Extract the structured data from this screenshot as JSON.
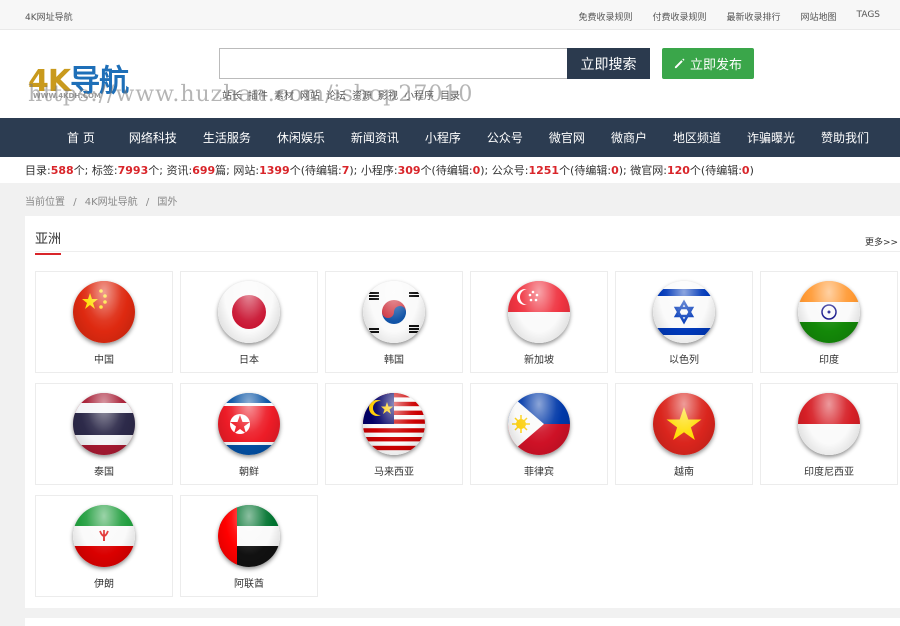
{
  "topbar": {
    "site_name": "4K网址导航",
    "links": [
      "免费收录规则",
      "付费收录规则",
      "最新收录排行",
      "网站地图",
      "TAGS"
    ]
  },
  "header": {
    "logo_text_k": "4K",
    "logo_text": "导航",
    "logo_sub": "WWW.4KDH.COM",
    "search_placeholder": "",
    "search_button": "立即搜索",
    "publish_button": "立即发布",
    "hotwords": [
      "站长",
      "插件",
      "素材",
      "网站",
      "论坛",
      "资源",
      "影视",
      "小程序",
      "目录"
    ],
    "watermark": "https://www.huzhan.com/ishop27010"
  },
  "nav": [
    "首 页",
    "网络科技",
    "生活服务",
    "休闲娱乐",
    "新闻资讯",
    "小程序",
    "公众号",
    "微官网",
    "微商户",
    "地区频道",
    "诈骗曝光",
    "赞助我们"
  ],
  "stats": {
    "dir_label": "目录:",
    "dir_count": "588",
    "dir_unit": "个;",
    "tag_label": "标签:",
    "tag_count": "7993",
    "tag_unit": "个;",
    "news_label": "资讯:",
    "news_count": "699",
    "news_unit": "篇;",
    "site_label": "网站:",
    "site_count": "1399",
    "site_pending_pre": "个(待编辑:",
    "site_pending": "7",
    "site_pending_post": ");",
    "mini_label": "小程序:",
    "mini_count": "309",
    "mini_pending_pre": "个(待编辑:",
    "mini_pending": "0",
    "mini_pending_post": ");",
    "mp_label": "公众号:",
    "mp_count": "1251",
    "mp_pending_pre": "个(待编辑:",
    "mp_pending": "0",
    "mp_pending_post": ");",
    "wg_label": "微官网:",
    "wg_count": "120",
    "wg_pending_pre": "个(待编辑:",
    "wg_pending": "0",
    "wg_pending_post": ")"
  },
  "breadcrumb": {
    "current": "当前位置",
    "sep": "/",
    "home": "4K网址导航",
    "page": "国外"
  },
  "section": {
    "title": "亚洲",
    "more": "更多>>",
    "countries": [
      {
        "name": "中国",
        "flag": "china-flag-icon"
      },
      {
        "name": "日本",
        "flag": "japan-flag-icon"
      },
      {
        "name": "韩国",
        "flag": "korea-flag-icon"
      },
      {
        "name": "新加坡",
        "flag": "singapore-flag-icon"
      },
      {
        "name": "以色列",
        "flag": "israel-flag-icon"
      },
      {
        "name": "印度",
        "flag": "india-flag-icon"
      },
      {
        "name": "泰国",
        "flag": "thailand-flag-icon"
      },
      {
        "name": "朝鲜",
        "flag": "north-korea-flag-icon"
      },
      {
        "name": "马来西亚",
        "flag": "malaysia-flag-icon"
      },
      {
        "name": "菲律宾",
        "flag": "philippines-flag-icon"
      },
      {
        "name": "越南",
        "flag": "vietnam-flag-icon"
      },
      {
        "name": "印度尼西亚",
        "flag": "indonesia-flag-icon"
      },
      {
        "name": "伊朗",
        "flag": "iran-flag-icon"
      },
      {
        "name": "阿联酋",
        "flag": "uae-flag-icon"
      }
    ]
  },
  "colors": {
    "nav_bg": "#2c3c51",
    "accent_red": "#d9252a",
    "publish_green": "#3aa64a"
  }
}
